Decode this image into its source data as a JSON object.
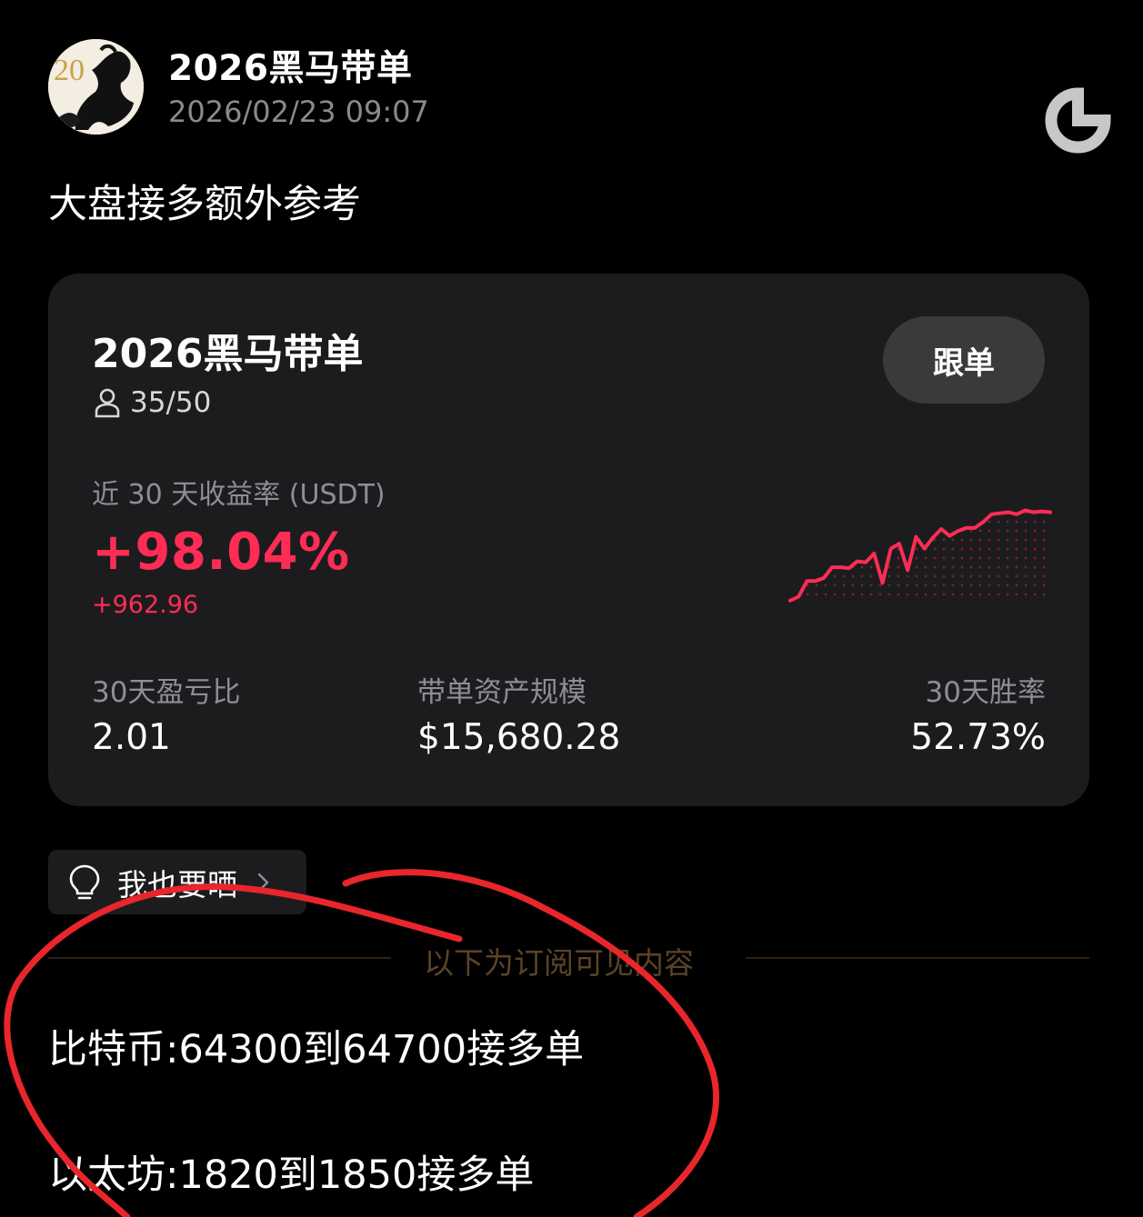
{
  "post": {
    "author": "2026黑马带单",
    "time": "2026/02/23 09:07",
    "text": "大盘接多额外参考"
  },
  "card": {
    "title": "2026黑马带单",
    "members": "35/50",
    "follow_label": "跟单",
    "roi_label": "近 30 天收益率 (USDT)",
    "roi_pct": "+98.04%",
    "roi_abs": "+962.96",
    "trend": [
      0.02,
      0.06,
      0.22,
      0.22,
      0.25,
      0.36,
      0.36,
      0.35,
      0.42,
      0.41,
      0.5,
      0.2,
      0.55,
      0.6,
      0.33,
      0.67,
      0.55,
      0.66,
      0.75,
      0.68,
      0.73,
      0.76,
      0.76,
      0.82,
      0.9,
      0.91,
      0.92,
      0.9,
      0.94,
      0.92,
      0.93,
      0.92
    ],
    "stats": [
      {
        "label": "30天盈亏比",
        "value": "2.01"
      },
      {
        "label": "带单资产规模",
        "value": "$15,680.28"
      },
      {
        "label": "30天胜率",
        "value": "52.73%"
      }
    ]
  },
  "share": {
    "label": "我也要晒"
  },
  "subscription_notice": "以下为订阅可见内容",
  "signals": [
    "比特币:64300到64700接多单",
    "以太坊:1820到1850接多单"
  ],
  "colors": {
    "profit": "#ff2d55",
    "card_bg": "#1c1c1e",
    "annotation": "#e8262c"
  },
  "icons": {
    "refresh": "refresh-icon",
    "member": "person-icon",
    "share": "lightbulb-icon",
    "share_arrow": "chevron-right-icon"
  }
}
